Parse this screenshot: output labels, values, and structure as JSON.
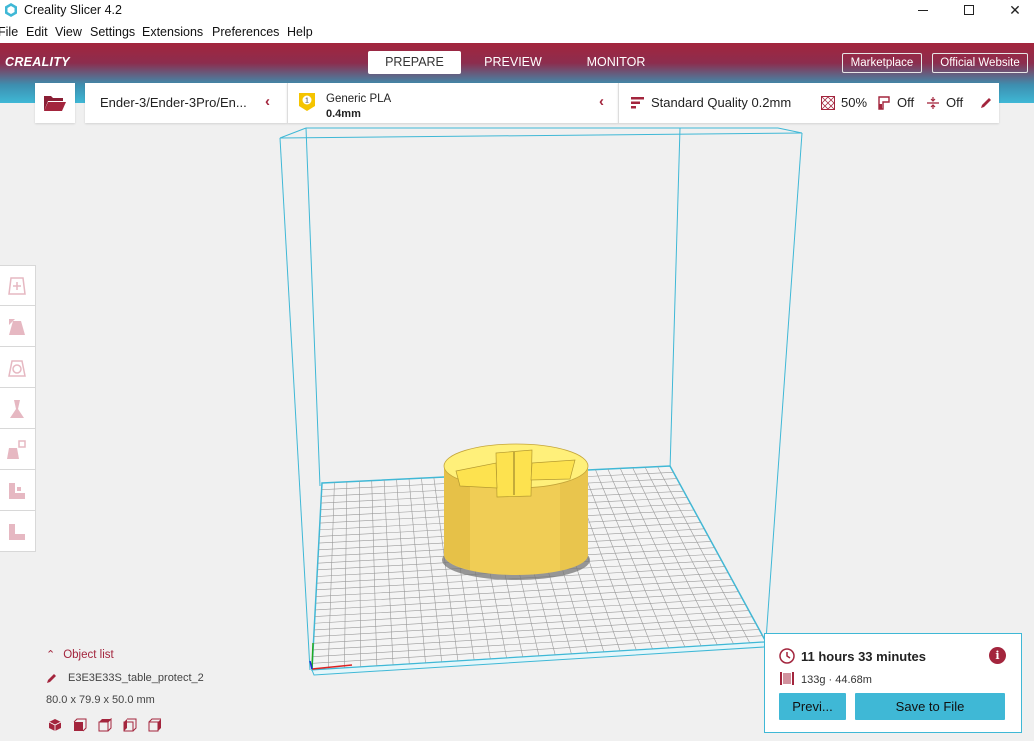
{
  "window": {
    "title": "Creality Slicer 4.2"
  },
  "menu": [
    {
      "label": "File"
    },
    {
      "label": "Edit"
    },
    {
      "label": "View"
    },
    {
      "label": "Settings"
    },
    {
      "label": "Extensions"
    },
    {
      "label": "Preferences"
    },
    {
      "label": "Help"
    }
  ],
  "header": {
    "logo": "CREALITY",
    "tabs": [
      {
        "label": "PREPARE",
        "active": true
      },
      {
        "label": "PREVIEW",
        "active": false
      },
      {
        "label": "MONITOR",
        "active": false
      }
    ],
    "marketplace": "Marketplace",
    "official_website": "Official Website"
  },
  "toolbar": {
    "printer": "Ender-3/Ender-3Pro/En...",
    "material_badge": "1",
    "material": "Generic PLA",
    "nozzle": "0.4mm",
    "quality": "Standard Quality 0.2mm",
    "infill": "50%",
    "support": "Off",
    "adhesion": "Off"
  },
  "left_tools": [
    "move-tool",
    "scale-tool",
    "rotate-tool",
    "mirror-tool",
    "per-model-settings-tool",
    "support-blocker-tool",
    "lay-flat-tool"
  ],
  "object_list": {
    "toggle_label": "Object list",
    "object_name": "E3E3E33S_table_protect_2",
    "dimensions": "80.0 x 79.9 x 50.0 mm"
  },
  "print_info": {
    "time": "11 hours 33 minutes",
    "material_usage": "133g · 44.68m",
    "preview_button": "Previ...",
    "save_button": "Save to File"
  },
  "colors": {
    "brand_red": "#a3253d",
    "accent_cyan": "#3fb8d6",
    "model_yellow": "#ffe066"
  }
}
